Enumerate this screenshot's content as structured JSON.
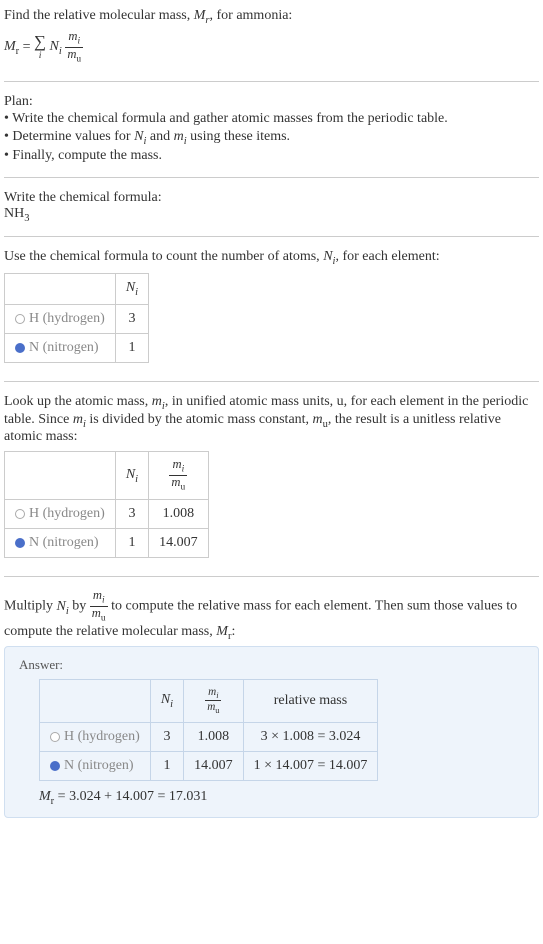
{
  "intro": {
    "line1": "Find the relative molecular mass, ",
    "symbol": "M",
    "sub_r": "r",
    "line1_end": ", for ammonia:",
    "eq_left": "M",
    "eq_sub": "r",
    "eq_equals": " = ",
    "sigma": "∑",
    "sigma_idx": "i",
    "N": "N",
    "N_sub": "i",
    "frac_num_m": "m",
    "frac_num_sub": "i",
    "frac_den_m": "m",
    "frac_den_sub": "u"
  },
  "plan": {
    "heading": "Plan:",
    "items": [
      "Write the chemical formula and gather atomic masses from the periodic table.",
      "Determine values for Nᵢ and mᵢ using these items.",
      "Finally, compute the mass."
    ],
    "item1_a": "Write the chemical formula and gather atomic masses from the periodic table.",
    "item2_a": "Determine values for ",
    "item2_b": " and ",
    "item2_c": " using these items.",
    "item3_a": "Finally, compute the mass."
  },
  "chemformula": {
    "heading": "Write the chemical formula:",
    "base": "NH",
    "sub": "3"
  },
  "count": {
    "heading_a": "Use the chemical formula to count the number of atoms, ",
    "heading_b": ", for each element:",
    "col_N": "N",
    "col_N_sub": "i",
    "rows": [
      {
        "swatch": "swatch-h",
        "label": "H (hydrogen)",
        "n": "3"
      },
      {
        "swatch": "swatch-n",
        "label": "N (nitrogen)",
        "n": "1"
      }
    ]
  },
  "lookup": {
    "heading_a": "Look up the atomic mass, ",
    "heading_b": ", in unified atomic mass units, u, for each element in the periodic table. Since ",
    "heading_c": " is divided by the atomic mass constant, ",
    "heading_d": ", the result is a unitless relative atomic mass:",
    "m": "m",
    "m_sub_i": "i",
    "m_sub_u": "u",
    "rows": [
      {
        "swatch": "swatch-h",
        "label": "H (hydrogen)",
        "n": "3",
        "mass": "1.008"
      },
      {
        "swatch": "swatch-n",
        "label": "N (nitrogen)",
        "n": "1",
        "mass": "14.007"
      }
    ]
  },
  "multiply": {
    "text_a": "Multiply ",
    "text_b": " by ",
    "text_c": " to compute the relative mass for each element. Then sum those values to compute the relative molecular mass, ",
    "text_d": ":"
  },
  "answer": {
    "label": "Answer:",
    "col_rel": "relative mass",
    "rows": [
      {
        "swatch": "swatch-h",
        "label": "H (hydrogen)",
        "n": "3",
        "mass": "1.008",
        "calc": "3 × 1.008 = 3.024"
      },
      {
        "swatch": "swatch-n",
        "label": "N (nitrogen)",
        "n": "1",
        "mass": "14.007",
        "calc": "1 × 14.007 = 14.007"
      }
    ],
    "final_a": "M",
    "final_sub": "r",
    "final_eq": " = 3.024 + 14.007 = 17.031"
  }
}
